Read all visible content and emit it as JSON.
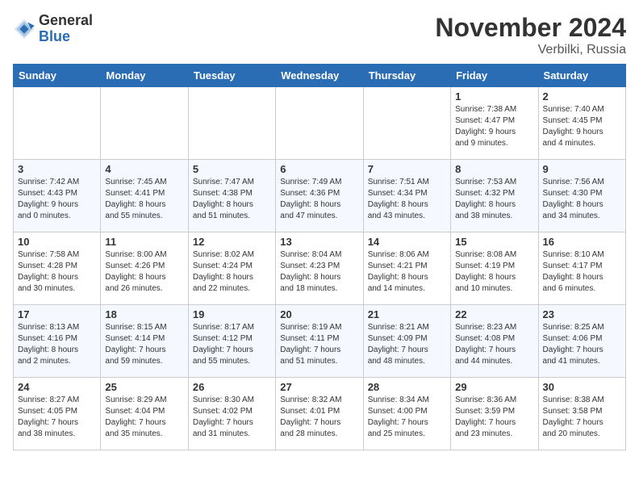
{
  "header": {
    "logo_general": "General",
    "logo_blue": "Blue",
    "month_title": "November 2024",
    "location": "Verbilki, Russia"
  },
  "days_of_week": [
    "Sunday",
    "Monday",
    "Tuesday",
    "Wednesday",
    "Thursday",
    "Friday",
    "Saturday"
  ],
  "weeks": [
    {
      "days": [
        {
          "num": "",
          "info": ""
        },
        {
          "num": "",
          "info": ""
        },
        {
          "num": "",
          "info": ""
        },
        {
          "num": "",
          "info": ""
        },
        {
          "num": "",
          "info": ""
        },
        {
          "num": "1",
          "info": "Sunrise: 7:38 AM\nSunset: 4:47 PM\nDaylight: 9 hours\nand 9 minutes."
        },
        {
          "num": "2",
          "info": "Sunrise: 7:40 AM\nSunset: 4:45 PM\nDaylight: 9 hours\nand 4 minutes."
        }
      ]
    },
    {
      "days": [
        {
          "num": "3",
          "info": "Sunrise: 7:42 AM\nSunset: 4:43 PM\nDaylight: 9 hours\nand 0 minutes."
        },
        {
          "num": "4",
          "info": "Sunrise: 7:45 AM\nSunset: 4:41 PM\nDaylight: 8 hours\nand 55 minutes."
        },
        {
          "num": "5",
          "info": "Sunrise: 7:47 AM\nSunset: 4:38 PM\nDaylight: 8 hours\nand 51 minutes."
        },
        {
          "num": "6",
          "info": "Sunrise: 7:49 AM\nSunset: 4:36 PM\nDaylight: 8 hours\nand 47 minutes."
        },
        {
          "num": "7",
          "info": "Sunrise: 7:51 AM\nSunset: 4:34 PM\nDaylight: 8 hours\nand 43 minutes."
        },
        {
          "num": "8",
          "info": "Sunrise: 7:53 AM\nSunset: 4:32 PM\nDaylight: 8 hours\nand 38 minutes."
        },
        {
          "num": "9",
          "info": "Sunrise: 7:56 AM\nSunset: 4:30 PM\nDaylight: 8 hours\nand 34 minutes."
        }
      ]
    },
    {
      "days": [
        {
          "num": "10",
          "info": "Sunrise: 7:58 AM\nSunset: 4:28 PM\nDaylight: 8 hours\nand 30 minutes."
        },
        {
          "num": "11",
          "info": "Sunrise: 8:00 AM\nSunset: 4:26 PM\nDaylight: 8 hours\nand 26 minutes."
        },
        {
          "num": "12",
          "info": "Sunrise: 8:02 AM\nSunset: 4:24 PM\nDaylight: 8 hours\nand 22 minutes."
        },
        {
          "num": "13",
          "info": "Sunrise: 8:04 AM\nSunset: 4:23 PM\nDaylight: 8 hours\nand 18 minutes."
        },
        {
          "num": "14",
          "info": "Sunrise: 8:06 AM\nSunset: 4:21 PM\nDaylight: 8 hours\nand 14 minutes."
        },
        {
          "num": "15",
          "info": "Sunrise: 8:08 AM\nSunset: 4:19 PM\nDaylight: 8 hours\nand 10 minutes."
        },
        {
          "num": "16",
          "info": "Sunrise: 8:10 AM\nSunset: 4:17 PM\nDaylight: 8 hours\nand 6 minutes."
        }
      ]
    },
    {
      "days": [
        {
          "num": "17",
          "info": "Sunrise: 8:13 AM\nSunset: 4:16 PM\nDaylight: 8 hours\nand 2 minutes."
        },
        {
          "num": "18",
          "info": "Sunrise: 8:15 AM\nSunset: 4:14 PM\nDaylight: 7 hours\nand 59 minutes."
        },
        {
          "num": "19",
          "info": "Sunrise: 8:17 AM\nSunset: 4:12 PM\nDaylight: 7 hours\nand 55 minutes."
        },
        {
          "num": "20",
          "info": "Sunrise: 8:19 AM\nSunset: 4:11 PM\nDaylight: 7 hours\nand 51 minutes."
        },
        {
          "num": "21",
          "info": "Sunrise: 8:21 AM\nSunset: 4:09 PM\nDaylight: 7 hours\nand 48 minutes."
        },
        {
          "num": "22",
          "info": "Sunrise: 8:23 AM\nSunset: 4:08 PM\nDaylight: 7 hours\nand 44 minutes."
        },
        {
          "num": "23",
          "info": "Sunrise: 8:25 AM\nSunset: 4:06 PM\nDaylight: 7 hours\nand 41 minutes."
        }
      ]
    },
    {
      "days": [
        {
          "num": "24",
          "info": "Sunrise: 8:27 AM\nSunset: 4:05 PM\nDaylight: 7 hours\nand 38 minutes."
        },
        {
          "num": "25",
          "info": "Sunrise: 8:29 AM\nSunset: 4:04 PM\nDaylight: 7 hours\nand 35 minutes."
        },
        {
          "num": "26",
          "info": "Sunrise: 8:30 AM\nSunset: 4:02 PM\nDaylight: 7 hours\nand 31 minutes."
        },
        {
          "num": "27",
          "info": "Sunrise: 8:32 AM\nSunset: 4:01 PM\nDaylight: 7 hours\nand 28 minutes."
        },
        {
          "num": "28",
          "info": "Sunrise: 8:34 AM\nSunset: 4:00 PM\nDaylight: 7 hours\nand 25 minutes."
        },
        {
          "num": "29",
          "info": "Sunrise: 8:36 AM\nSunset: 3:59 PM\nDaylight: 7 hours\nand 23 minutes."
        },
        {
          "num": "30",
          "info": "Sunrise: 8:38 AM\nSunset: 3:58 PM\nDaylight: 7 hours\nand 20 minutes."
        }
      ]
    }
  ]
}
